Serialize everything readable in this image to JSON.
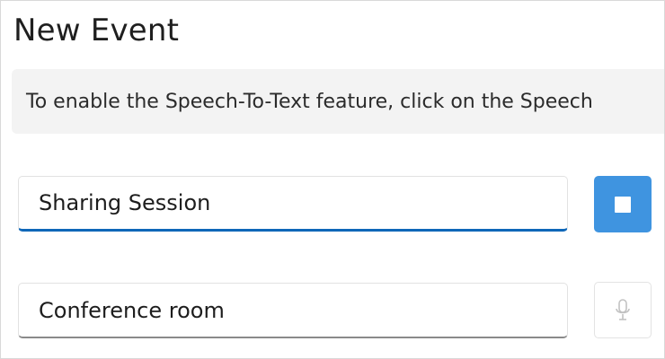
{
  "header": {
    "title": "New Event"
  },
  "info": {
    "text": "To enable the Speech-To-Text feature, click on the Speech"
  },
  "fields": {
    "event_title_value": "Sharing Session",
    "location_value": "Conference room"
  },
  "buttons": {
    "stop_icon": "stop-icon",
    "mic_icon": "microphone-icon"
  },
  "colors": {
    "accent": "#3f94e0",
    "focus_underline": "#0f67b8",
    "banner_bg": "#f3f3f3"
  }
}
